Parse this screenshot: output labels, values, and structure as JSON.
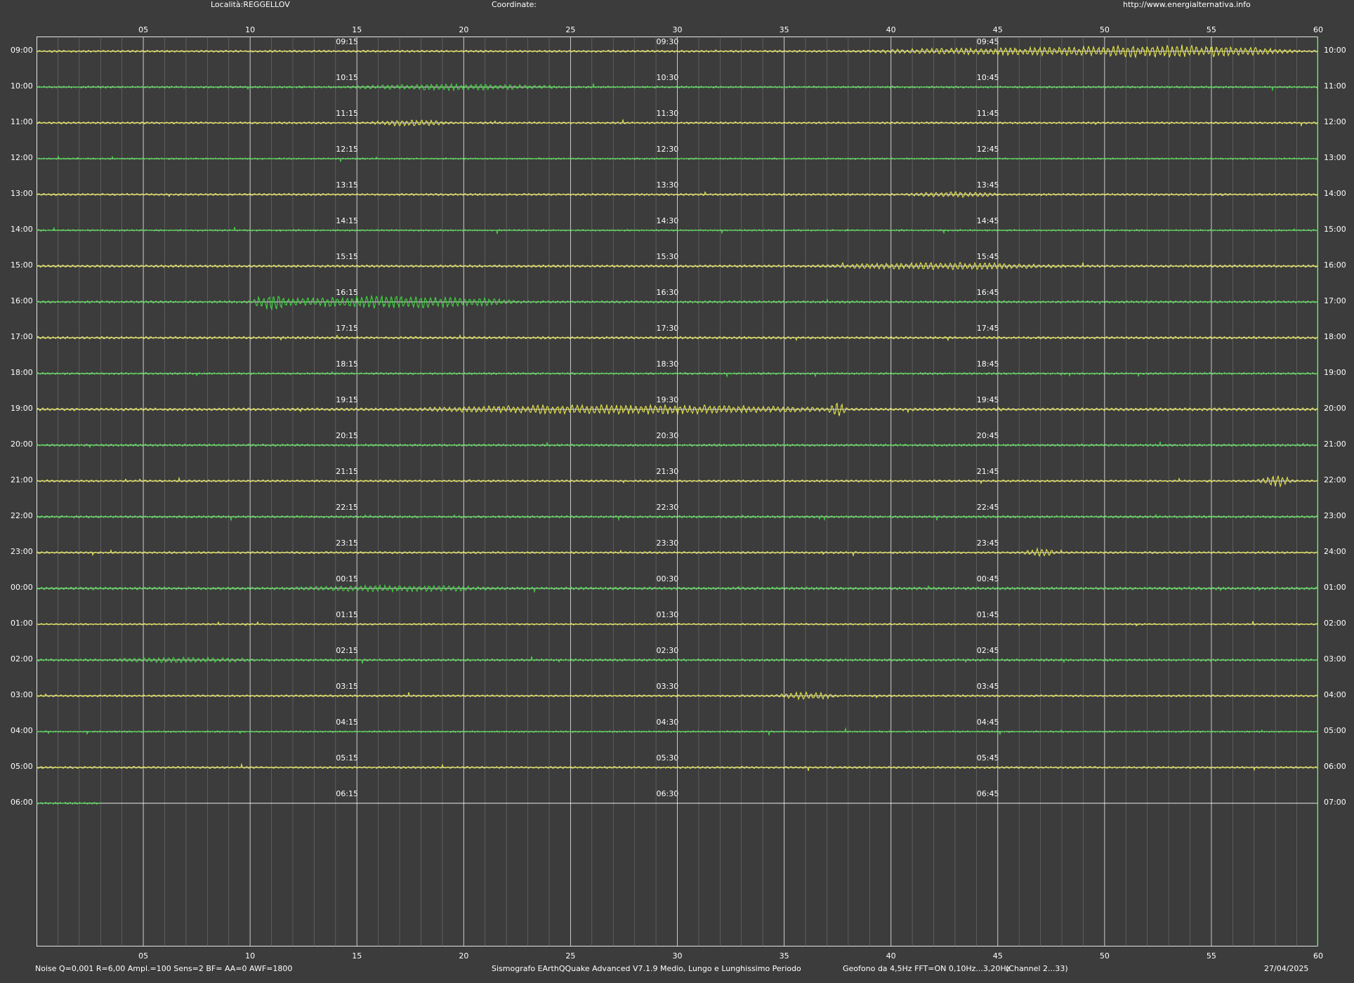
{
  "header": {
    "location": "Località:REGGELLOV",
    "coordinates": "Coordinate:",
    "website": "http://www.energialternativa.info"
  },
  "minute_ticks": [
    "05",
    "10",
    "15",
    "20",
    "25",
    "30",
    "35",
    "40",
    "45",
    "50",
    "55",
    "60"
  ],
  "left_hours": [
    "09:00",
    "10:00",
    "11:00",
    "12:00",
    "13:00",
    "14:00",
    "15:00",
    "16:00",
    "17:00",
    "18:00",
    "19:00",
    "20:00",
    "21:00",
    "22:00",
    "23:00",
    "00:00",
    "01:00",
    "02:00",
    "03:00",
    "04:00",
    "05:00",
    "06:00"
  ],
  "right_hours": [
    "10:00",
    "11:00",
    "12:00",
    "13:00",
    "14:00",
    "15:00",
    "16:00",
    "17:00",
    "18:00",
    "19:00",
    "20:00",
    "21:00",
    "22:00",
    "23:00",
    "24:00",
    "01:00",
    "02:00",
    "03:00",
    "04:00",
    "05:00",
    "06:00",
    "07:00"
  ],
  "quarter_labels": [
    [
      "09:15",
      "09:30",
      "09:45"
    ],
    [
      "10:15",
      "10:30",
      "10:45"
    ],
    [
      "11:15",
      "11:30",
      "11:45"
    ],
    [
      "12:15",
      "12:30",
      "12:45"
    ],
    [
      "13:15",
      "13:30",
      "13:45"
    ],
    [
      "14:15",
      "14:30",
      "14:45"
    ],
    [
      "15:15",
      "15:30",
      "15:45"
    ],
    [
      "16:15",
      "16:30",
      "16:45"
    ],
    [
      "17:15",
      "17:30",
      "17:45"
    ],
    [
      "18:15",
      "18:30",
      "18:45"
    ],
    [
      "19:15",
      "19:30",
      "19:45"
    ],
    [
      "20:15",
      "20:30",
      "20:45"
    ],
    [
      "21:15",
      "21:30",
      "21:45"
    ],
    [
      "22:15",
      "22:30",
      "22:45"
    ],
    [
      "23:15",
      "23:30",
      "23:45"
    ],
    [
      "00:15",
      "00:30",
      "00:45"
    ],
    [
      "01:15",
      "01:30",
      "01:45"
    ],
    [
      "02:15",
      "02:30",
      "02:45"
    ],
    [
      "03:15",
      "03:30",
      "03:45"
    ],
    [
      "04:15",
      "04:30",
      "04:45"
    ],
    [
      "05:15",
      "05:30",
      "05:45"
    ],
    [
      "06:15",
      "06:30",
      "06:45"
    ]
  ],
  "trace_colors": [
    "#e8e84a",
    "#3fd83f"
  ],
  "traces": [
    {
      "hour": "09:00",
      "color": "#e8e84a",
      "noise": 0.25,
      "events": [
        {
          "start": 36,
          "end": 60,
          "amp": 1.0
        },
        {
          "start": 45,
          "end": 60,
          "amp": 1.6
        }
      ],
      "duration_min": 60
    },
    {
      "hour": "10:00",
      "color": "#3fd83f",
      "noise": 0.25,
      "events": [
        {
          "start": 13,
          "end": 26,
          "amp": 0.8
        }
      ],
      "duration_min": 60
    },
    {
      "hour": "11:00",
      "color": "#e8e84a",
      "noise": 0.25,
      "events": [
        {
          "start": 15,
          "end": 20,
          "amp": 0.8
        }
      ],
      "duration_min": 60
    },
    {
      "hour": "12:00",
      "color": "#3fd83f",
      "noise": 0.2,
      "events": [],
      "duration_min": 60
    },
    {
      "hour": "13:00",
      "color": "#e8e84a",
      "noise": 0.25,
      "events": [
        {
          "start": 40,
          "end": 46,
          "amp": 0.7
        }
      ],
      "duration_min": 60
    },
    {
      "hour": "14:00",
      "color": "#3fd83f",
      "noise": 0.2,
      "events": [],
      "duration_min": 60
    },
    {
      "hour": "15:00",
      "color": "#e8e84a",
      "noise": 0.3,
      "events": [
        {
          "start": 35,
          "end": 50,
          "amp": 0.9
        }
      ],
      "duration_min": 60
    },
    {
      "hour": "16:00",
      "color": "#3fd83f",
      "noise": 0.3,
      "events": [
        {
          "start": 9,
          "end": 24,
          "amp": 1.6
        },
        {
          "start": 10,
          "end": 12,
          "amp": 2.4
        }
      ],
      "duration_min": 60
    },
    {
      "hour": "17:00",
      "color": "#e8e84a",
      "noise": 0.3,
      "events": [],
      "duration_min": 60
    },
    {
      "hour": "18:00",
      "color": "#3fd83f",
      "noise": 0.25,
      "events": [],
      "duration_min": 60
    },
    {
      "hour": "19:00",
      "color": "#e8e84a",
      "noise": 0.35,
      "events": [
        {
          "start": 15,
          "end": 40,
          "amp": 1.2
        },
        {
          "start": 37,
          "end": 38,
          "amp": 2.0
        }
      ],
      "duration_min": 60
    },
    {
      "hour": "20:00",
      "color": "#3fd83f",
      "noise": 0.3,
      "events": [],
      "duration_min": 60
    },
    {
      "hour": "21:00",
      "color": "#e8e84a",
      "noise": 0.25,
      "events": [
        {
          "start": 57,
          "end": 59,
          "amp": 1.4
        }
      ],
      "duration_min": 60
    },
    {
      "hour": "22:00",
      "color": "#3fd83f",
      "noise": 0.3,
      "events": [],
      "duration_min": 60
    },
    {
      "hour": "23:00",
      "color": "#e8e84a",
      "noise": 0.25,
      "events": [
        {
          "start": 46,
          "end": 48,
          "amp": 1.0
        }
      ],
      "duration_min": 60
    },
    {
      "hour": "00:00",
      "color": "#3fd83f",
      "noise": 0.35,
      "events": [
        {
          "start": 10,
          "end": 24,
          "amp": 0.8
        }
      ],
      "duration_min": 60
    },
    {
      "hour": "01:00",
      "color": "#e8e84a",
      "noise": 0.2,
      "events": [],
      "duration_min": 60
    },
    {
      "hour": "02:00",
      "color": "#3fd83f",
      "noise": 0.3,
      "events": [
        {
          "start": 2,
          "end": 12,
          "amp": 0.7
        }
      ],
      "duration_min": 60
    },
    {
      "hour": "03:00",
      "color": "#e8e84a",
      "noise": 0.25,
      "events": [
        {
          "start": 34,
          "end": 38,
          "amp": 0.9
        }
      ],
      "duration_min": 60
    },
    {
      "hour": "04:00",
      "color": "#3fd83f",
      "noise": 0.2,
      "events": [],
      "duration_min": 60
    },
    {
      "hour": "05:00",
      "color": "#e8e84a",
      "noise": 0.25,
      "events": [],
      "duration_min": 60
    },
    {
      "hour": "06:00",
      "color": "#3fd83f",
      "noise": 0.25,
      "events": [],
      "duration_min": 3
    }
  ],
  "footer": {
    "params": "Noise Q=0,001 R=6,00 Ampl.=100 Sens=2 BF= AA=0 AWF=1800",
    "software": "Sismografo  EArthQQuake Advanced V7.1.9  Medio, Lungo e Lunghissimo Periodo",
    "sensor": "Geofono da 4,5Hz FFT=ON 0,10Hz...3,20Hz",
    "channel": "(Channel 2...33)",
    "date": "27/04/2025"
  },
  "colors": {
    "background": "#3c3c3c",
    "grid_major": "#e6e6e6",
    "grid_minor": "#8a8a8a",
    "baseline": "#ffffff"
  }
}
